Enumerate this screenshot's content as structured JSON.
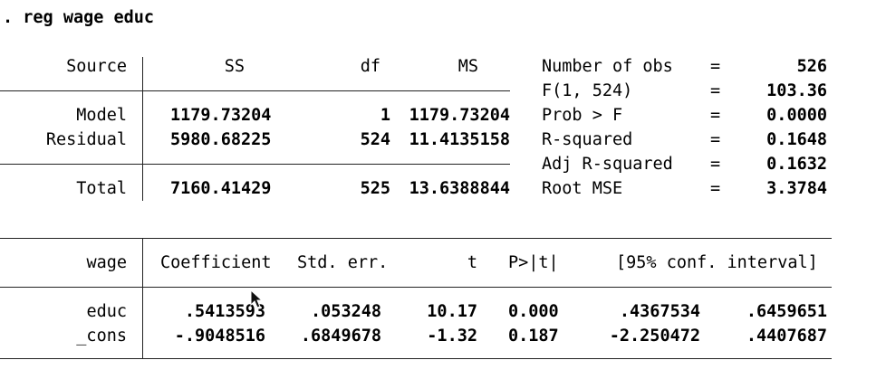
{
  "command": ". reg wage educ",
  "anova": {
    "headers": {
      "source": "Source",
      "ss": "SS",
      "df": "df",
      "ms": "MS"
    },
    "rows": [
      {
        "source": "Model",
        "ss": "1179.73204",
        "df": "1",
        "ms": "1179.73204"
      },
      {
        "source": "Residual",
        "ss": "5980.68225",
        "df": "524",
        "ms": "11.4135158"
      },
      {
        "source": "Total",
        "ss": "7160.41429",
        "df": "525",
        "ms": "13.6388844"
      }
    ]
  },
  "fit_stats": [
    {
      "label": "Number of obs",
      "eq": "=",
      "value": "526"
    },
    {
      "label": "F(1, 524)",
      "eq": "=",
      "value": "103.36"
    },
    {
      "label": "Prob > F",
      "eq": "=",
      "value": "0.0000"
    },
    {
      "label": "R-squared",
      "eq": "=",
      "value": "0.1648"
    },
    {
      "label": "Adj R-squared",
      "eq": "=",
      "value": "0.1632"
    },
    {
      "label": "Root MSE",
      "eq": "=",
      "value": "3.3784"
    }
  ],
  "coef_table": {
    "headers": {
      "var": "wage",
      "coef": "Coefficient",
      "se": "Std. err.",
      "t": "t",
      "p": "P>|t|",
      "ci": "[95% conf. interval]"
    },
    "rows": [
      {
        "var": "educ",
        "coef": ".5413593",
        "se": ".053248",
        "t": "10.17",
        "p": "0.000",
        "ci_lo": ".4367534",
        "ci_hi": ".6459651"
      },
      {
        "var": "_cons",
        "coef": "-.9048516",
        "se": ".6849678",
        "t": "-1.32",
        "p": "0.187",
        "ci_lo": "-2.250472",
        "ci_hi": ".4407687"
      }
    ]
  }
}
